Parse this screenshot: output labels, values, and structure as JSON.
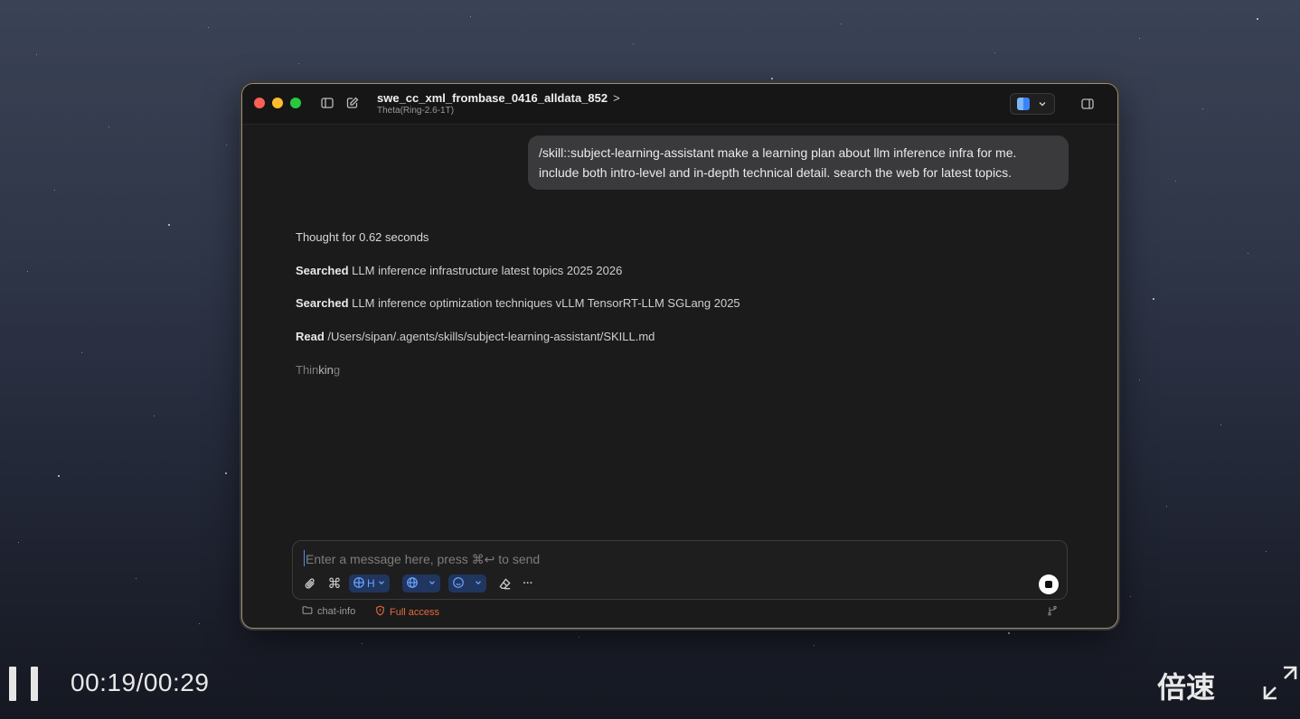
{
  "window": {
    "title": "swe_cc_xml_frombase_0416_alldata_852",
    "title_chevron": ">",
    "subtitle": "Theta(Ring-2.6-1T)"
  },
  "chat": {
    "user_message": "/skill::subject-learning-assistant  make a learning plan about llm inference infra for me. include both intro-level and in-depth technical detail. search the web for latest topics.",
    "thought": "Thought for 0.62 seconds",
    "steps": [
      {
        "verb": "Searched",
        "text": "LLM inference infrastructure latest topics 2025 2026"
      },
      {
        "verb": "Searched",
        "text": "LLM inference optimization techniques vLLM TensorRT-LLM SGLang 2025"
      },
      {
        "verb": "Read",
        "text": "/Users/sipan/.agents/skills/subject-learning-assistant/SKILL.md"
      }
    ],
    "thinking_pre": "Thin",
    "thinking_hl": "kin",
    "thinking_post": "g"
  },
  "composer": {
    "placeholder": "Enter a message here, press ⌘↩ to send",
    "model_pill_label": "H",
    "more_label": "···"
  },
  "statusbar": {
    "folder": "chat-info",
    "access": "Full access"
  },
  "player": {
    "time": "00:19/00:29",
    "speed_label": "倍速"
  },
  "colors": {
    "accent": "#4c8dff",
    "warning": "#e56a3c",
    "bubble": "#3a3a3c"
  },
  "icons": [
    "sidebar-icon",
    "compose-icon",
    "finder-icon",
    "chevron-down-icon",
    "panel-icon",
    "paperclip-icon",
    "command-icon",
    "globe-icon",
    "emoji-icon",
    "eraser-icon",
    "stop-icon",
    "folder-icon",
    "shield-icon",
    "branch-icon",
    "pause-icon",
    "fullscreen-icon"
  ]
}
